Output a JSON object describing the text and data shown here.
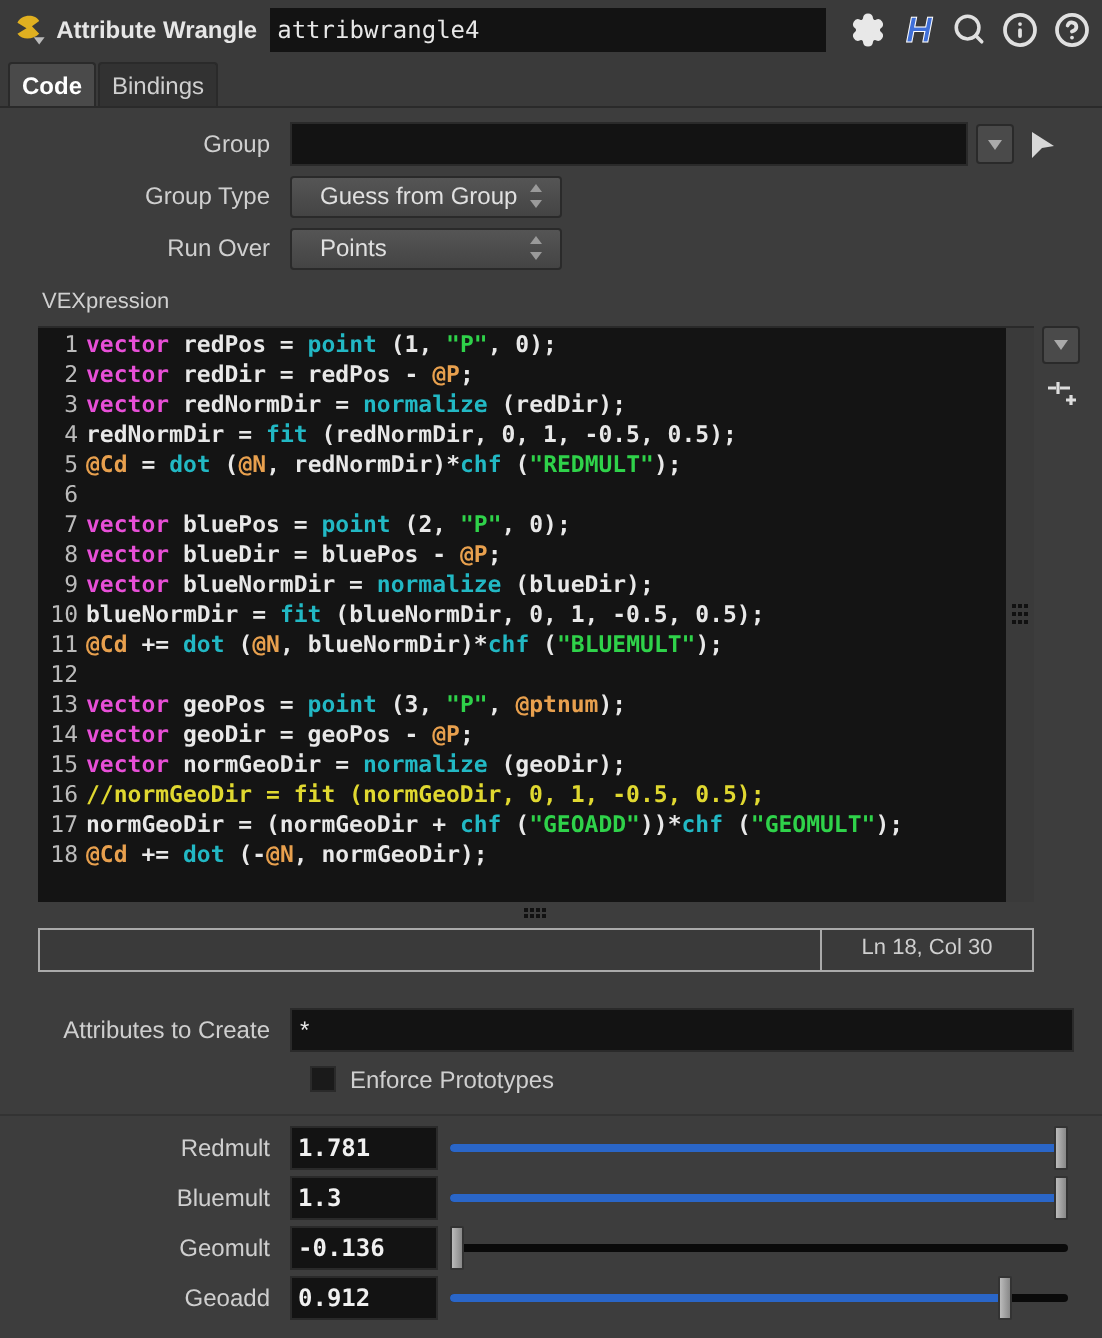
{
  "header": {
    "node_type": "Attribute Wrangle",
    "node_name": "attribwrangle4",
    "logo_letter": "H"
  },
  "tabs": [
    {
      "label": "Code",
      "selected": true
    },
    {
      "label": "Bindings",
      "selected": false
    }
  ],
  "params": [
    {
      "kind": "field",
      "label": "Group"
    },
    {
      "kind": "menu",
      "label": "Group Type",
      "value": "Guess from Group"
    },
    {
      "kind": "menu",
      "label": "Run Over",
      "value": "Points"
    }
  ],
  "editor": {
    "label": "VEXpression",
    "status": "Ln 18, Col 30",
    "lines": [
      {
        "number": "1",
        "tokens": [
          {
            "kind": "keyword",
            "text": "vector"
          },
          {
            "kind": "plain",
            "text": " redPos = "
          },
          {
            "kind": "function",
            "text": "point"
          },
          {
            "kind": "plain",
            "text": " (1, "
          },
          {
            "kind": "string",
            "text": "\"P\""
          },
          {
            "kind": "plain",
            "text": ", 0);"
          }
        ]
      },
      {
        "number": "2",
        "tokens": [
          {
            "kind": "keyword",
            "text": "vector"
          },
          {
            "kind": "plain",
            "text": " redDir = redPos - "
          },
          {
            "kind": "attribute",
            "text": "@P"
          },
          {
            "kind": "plain",
            "text": ";"
          }
        ]
      },
      {
        "number": "3",
        "tokens": [
          {
            "kind": "keyword",
            "text": "vector"
          },
          {
            "kind": "plain",
            "text": " redNormDir = "
          },
          {
            "kind": "function",
            "text": "normalize"
          },
          {
            "kind": "plain",
            "text": " (redDir);"
          }
        ]
      },
      {
        "number": "4",
        "tokens": [
          {
            "kind": "plain",
            "text": "redNormDir = "
          },
          {
            "kind": "function",
            "text": "fit"
          },
          {
            "kind": "plain",
            "text": " (redNormDir, 0, 1, -0.5, 0.5);"
          }
        ]
      },
      {
        "number": "5",
        "tokens": [
          {
            "kind": "attribute",
            "text": "@Cd"
          },
          {
            "kind": "plain",
            "text": " = "
          },
          {
            "kind": "function",
            "text": "dot"
          },
          {
            "kind": "plain",
            "text": " ("
          },
          {
            "kind": "attribute",
            "text": "@N"
          },
          {
            "kind": "plain",
            "text": ", redNormDir)*"
          },
          {
            "kind": "function",
            "text": "chf"
          },
          {
            "kind": "plain",
            "text": " ("
          },
          {
            "kind": "string",
            "text": "\"REDMULT\""
          },
          {
            "kind": "plain",
            "text": ");"
          }
        ]
      },
      {
        "number": "6"
      },
      {
        "number": "7",
        "tokens": [
          {
            "kind": "keyword",
            "text": "vector"
          },
          {
            "kind": "plain",
            "text": " bluePos = "
          },
          {
            "kind": "function",
            "text": "point"
          },
          {
            "kind": "plain",
            "text": " (2, "
          },
          {
            "kind": "string",
            "text": "\"P\""
          },
          {
            "kind": "plain",
            "text": ", 0);"
          }
        ]
      },
      {
        "number": "8",
        "tokens": [
          {
            "kind": "keyword",
            "text": "vector"
          },
          {
            "kind": "plain",
            "text": " blueDir = bluePos - "
          },
          {
            "kind": "attribute",
            "text": "@P"
          },
          {
            "kind": "plain",
            "text": ";"
          }
        ]
      },
      {
        "number": "9",
        "tokens": [
          {
            "kind": "keyword",
            "text": "vector"
          },
          {
            "kind": "plain",
            "text": " blueNormDir = "
          },
          {
            "kind": "function",
            "text": "normalize"
          },
          {
            "kind": "plain",
            "text": " (blueDir);"
          }
        ]
      },
      {
        "number": "10",
        "tokens": [
          {
            "kind": "plain",
            "text": "blueNormDir = "
          },
          {
            "kind": "function",
            "text": "fit"
          },
          {
            "kind": "plain",
            "text": " (blueNormDir, 0, 1, -0.5, 0.5);"
          }
        ]
      },
      {
        "number": "11",
        "tokens": [
          {
            "kind": "attribute",
            "text": "@Cd"
          },
          {
            "kind": "plain",
            "text": " += "
          },
          {
            "kind": "function",
            "text": "dot"
          },
          {
            "kind": "plain",
            "text": " ("
          },
          {
            "kind": "attribute",
            "text": "@N"
          },
          {
            "kind": "plain",
            "text": ", blueNormDir)*"
          },
          {
            "kind": "function",
            "text": "chf"
          },
          {
            "kind": "plain",
            "text": " ("
          },
          {
            "kind": "string",
            "text": "\"BLUEMULT\""
          },
          {
            "kind": "plain",
            "text": ");"
          }
        ]
      },
      {
        "number": "12"
      },
      {
        "number": "13",
        "tokens": [
          {
            "kind": "keyword",
            "text": "vector"
          },
          {
            "kind": "plain",
            "text": " geoPos = "
          },
          {
            "kind": "function",
            "text": "point"
          },
          {
            "kind": "plain",
            "text": " (3, "
          },
          {
            "kind": "string",
            "text": "\"P\""
          },
          {
            "kind": "plain",
            "text": ", "
          },
          {
            "kind": "attribute",
            "text": "@ptnum"
          },
          {
            "kind": "plain",
            "text": ");"
          }
        ]
      },
      {
        "number": "14",
        "tokens": [
          {
            "kind": "keyword",
            "text": "vector"
          },
          {
            "kind": "plain",
            "text": " geoDir = geoPos - "
          },
          {
            "kind": "attribute",
            "text": "@P"
          },
          {
            "kind": "plain",
            "text": ";"
          }
        ]
      },
      {
        "number": "15",
        "tokens": [
          {
            "kind": "keyword",
            "text": "vector"
          },
          {
            "kind": "plain",
            "text": " normGeoDir = "
          },
          {
            "kind": "function",
            "text": "normalize"
          },
          {
            "kind": "plain",
            "text": " (geoDir);"
          }
        ]
      },
      {
        "number": "16",
        "tokens": [
          {
            "kind": "comment",
            "text": "//normGeoDir = fit (normGeoDir, 0, 1, -0.5, 0.5);"
          }
        ]
      },
      {
        "number": "17",
        "tokens": [
          {
            "kind": "plain",
            "text": "normGeoDir = (normGeoDir + "
          },
          {
            "kind": "function",
            "text": "chf"
          },
          {
            "kind": "plain",
            "text": " ("
          },
          {
            "kind": "string",
            "text": "\"GEOADD\""
          },
          {
            "kind": "plain",
            "text": "))*"
          },
          {
            "kind": "function",
            "text": "chf"
          },
          {
            "kind": "plain",
            "text": " ("
          },
          {
            "kind": "string",
            "text": "\"GEOMULT\""
          },
          {
            "kind": "plain",
            "text": ");"
          }
        ]
      },
      {
        "number": "18",
        "tokens": [
          {
            "kind": "attribute",
            "text": "@Cd"
          },
          {
            "kind": "plain",
            "text": " += "
          },
          {
            "kind": "function",
            "text": "dot"
          },
          {
            "kind": "plain",
            "text": " (-"
          },
          {
            "kind": "attribute",
            "text": "@N"
          },
          {
            "kind": "plain",
            "text": ", normGeoDir);"
          }
        ]
      }
    ]
  },
  "attributes": {
    "label": "Attributes to Create",
    "value": "*"
  },
  "enforce": {
    "label": "Enforce Prototypes",
    "checked": false
  },
  "sliders": [
    {
      "label": "Redmult",
      "value": "1.781",
      "level": 1.0
    },
    {
      "label": "Bluemult",
      "value": "1.3",
      "level": 1.0
    },
    {
      "label": "Geomult",
      "value": "-0.136",
      "level": 0.0
    },
    {
      "label": "Geoadd",
      "value": "0.912",
      "level": 0.906
    }
  ]
}
